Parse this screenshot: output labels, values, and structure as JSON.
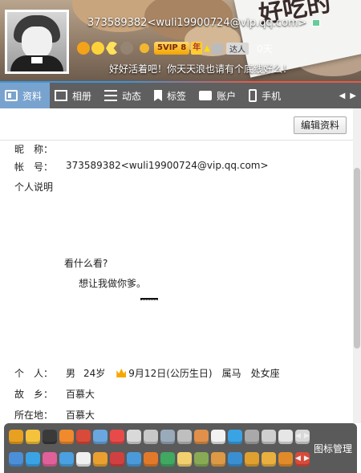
{
  "header": {
    "account_line": "373589382<wuli19900724@vip.qq.com>",
    "svip_label": "5VIP 8",
    "year_label": "年",
    "daren_label": "达人",
    "daren_days": "0天",
    "signature": "好好活着吧！你天天浪也请有个底线好么！",
    "card_text": "好吃的"
  },
  "tabs": [
    {
      "label": "资料",
      "icon": "profile-card-icon"
    },
    {
      "label": "相册",
      "icon": "photo-icon"
    },
    {
      "label": "动态",
      "icon": "list-icon"
    },
    {
      "label": "标签",
      "icon": "tag-icon"
    },
    {
      "label": "账户",
      "icon": "wallet-icon"
    },
    {
      "label": "手机",
      "icon": "phone-icon"
    }
  ],
  "profile": {
    "edit_button": "编辑资料",
    "nickname_label": "昵　称：",
    "nickname_value": "",
    "account_label": "帐　号：",
    "account_value": "373589382<wuli19900724@vip.qq.com>",
    "intro_label": "个人说明",
    "intro_line1": "看什么看?",
    "intro_line2": "想让我做你爹。",
    "personal_label": "个　人：",
    "gender": "男",
    "age": "24岁",
    "birthday": "9月12日(公历生日)",
    "zodiac": "属马",
    "star_sign": "处女座",
    "hometown_label": "故　乡：",
    "hometown_value": "百慕大",
    "location_label": "所在地：",
    "location_value": "百慕大"
  },
  "tray": {
    "manage_label": "图标管理",
    "row1_colors": [
      "#e8a020",
      "#f5c33b",
      "#3a3a3a",
      "#f08a2c",
      "#d84a3a",
      "#6aa7e0",
      "#e84a4a",
      "#d9d9d9",
      "#c8c8c8",
      "#9ab",
      "#bfbfbf",
      "#e0904a",
      "#f2f2f2",
      "#3aa3e3",
      "#a9a9a9",
      "#cfcfcf",
      "#e6e6e6",
      "#d8d8d8"
    ],
    "row2_colors": [
      "#4b8fd8",
      "#3aa3e3",
      "#e0609a",
      "#4aa0e0",
      "#f0f0f0",
      "#e9a030",
      "#d04040",
      "#4a9ad9",
      "#e07a2a",
      "#40a860",
      "#f2d070",
      "#8a5",
      "#d94",
      "#3a8fd0",
      "#e0a030",
      "#e9b040",
      "#e08a2a",
      "#d84a3a"
    ]
  }
}
